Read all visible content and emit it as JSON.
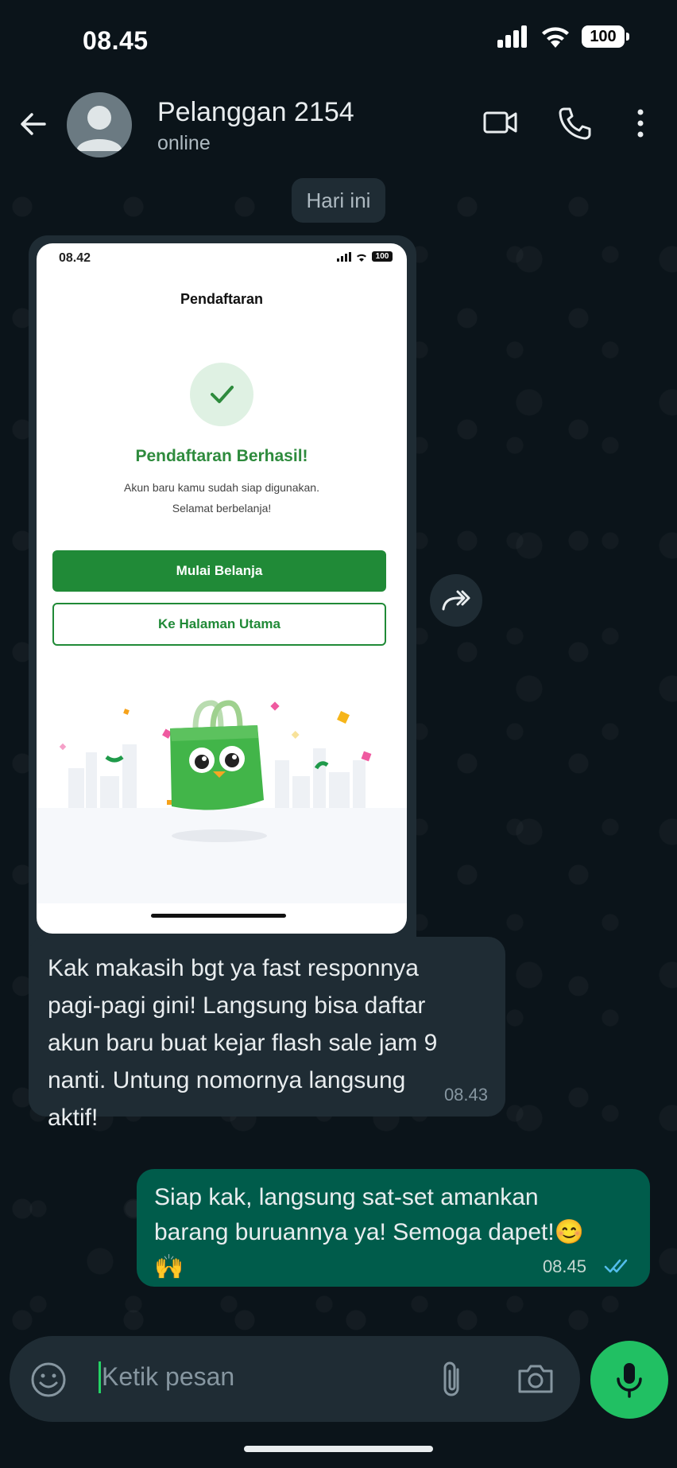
{
  "status_bar": {
    "time": "08.45",
    "battery": "100"
  },
  "header": {
    "contact_name": "Pelanggan 2154",
    "status": "online"
  },
  "chat": {
    "date_chip": "Hari ini",
    "screenshot": {
      "time": "08.42",
      "battery": "100",
      "title": "Pendaftaran",
      "success_title": "Pendaftaran Berhasil!",
      "desc_lines": [
        "Akun baru kamu sudah siap digunakan.",
        "Selamat berbelanja!"
      ],
      "primary_button": "Mulai Belanja",
      "secondary_button": "Ke Halaman Utama"
    },
    "incoming_message": {
      "lines": [
        "Kak makasih bgt ya fast responnya",
        "pagi-pagi gini! Langsung bisa daftar",
        "akun baru buat kejar flash sale jam 9",
        "nanti. Untung nomornya langsung",
        "aktif!"
      ],
      "time": "08.43"
    },
    "outgoing_message": {
      "lines": [
        "Siap kak, langsung sat-set amankan",
        "barang buruannya ya! Semoga dapet!😊",
        "🙌"
      ],
      "time": "08.45",
      "status": "read"
    }
  },
  "input": {
    "placeholder": "Ketik pesan"
  },
  "colors": {
    "accent": "#21c063",
    "outgoing_bubble": "#005c4b",
    "incoming_bubble": "#1f2c34",
    "tick_read": "#53bdeb"
  }
}
